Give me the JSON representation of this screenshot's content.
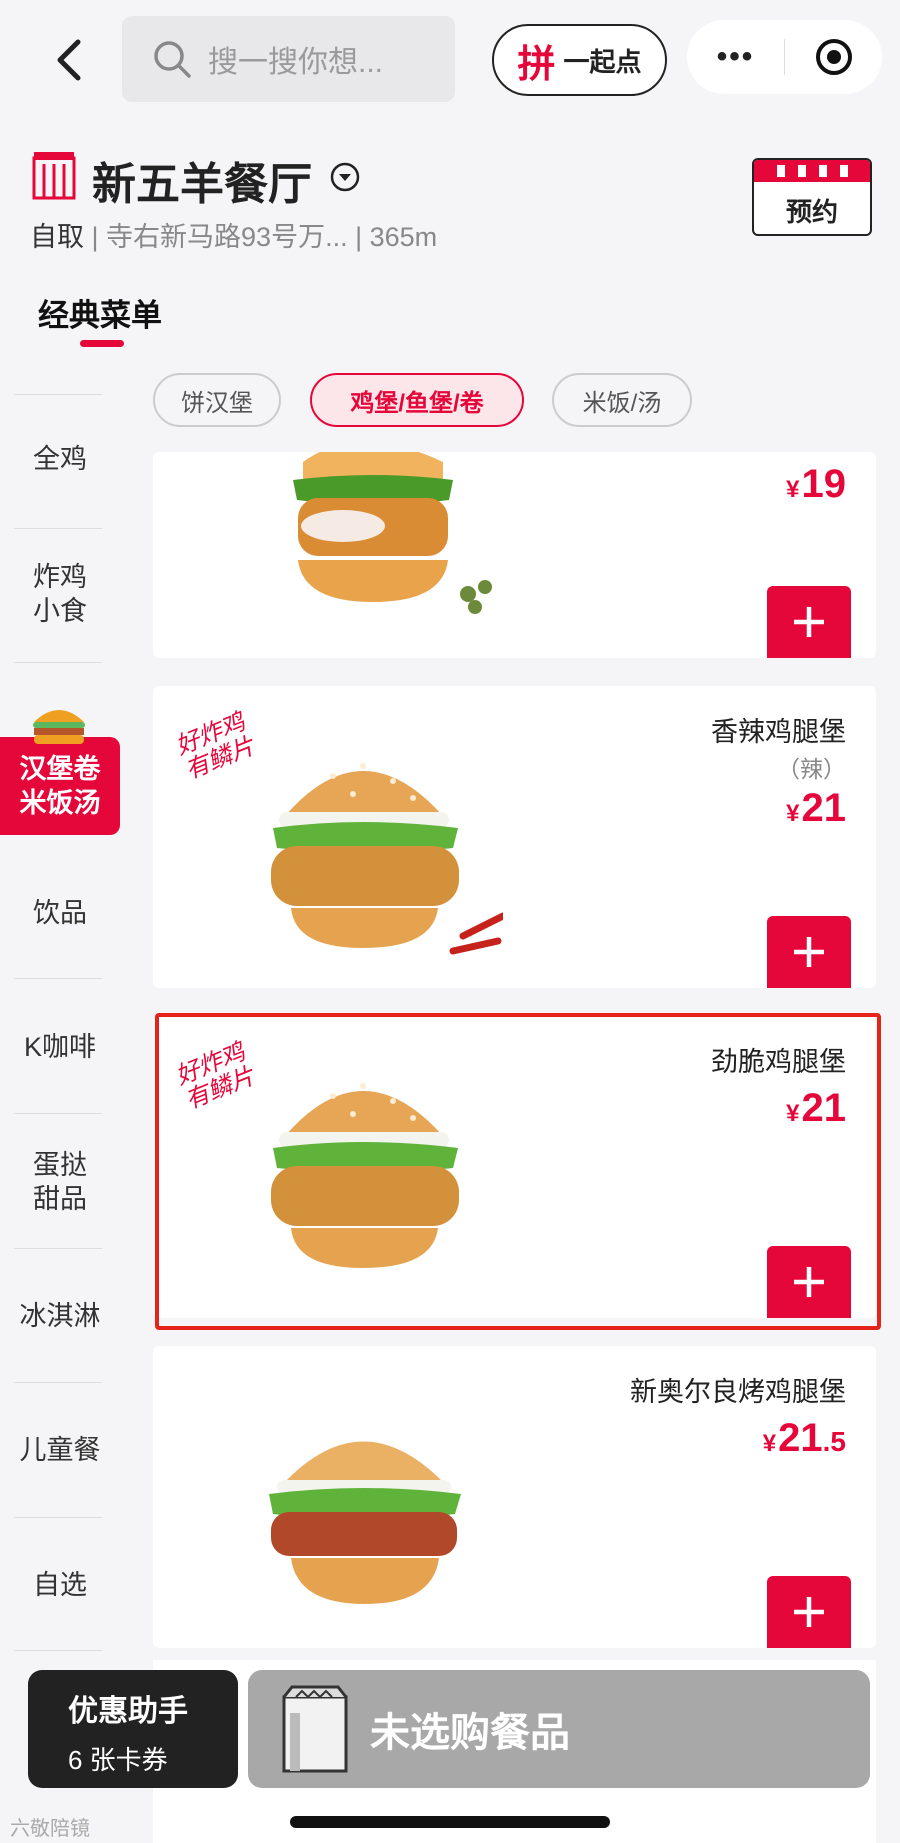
{
  "header": {
    "search_placeholder": "搜一搜你想...",
    "group_pin_glyph": "拼",
    "group_label": "一起点",
    "more_label": "•••"
  },
  "store": {
    "name": "新五羊餐厅",
    "pickup": "自取",
    "address": "| 寺右新马路93号万... | 365m",
    "reserve_label": "预约"
  },
  "menu_tab": "经典菜单",
  "sidebar": {
    "items": [
      "全鸡",
      "炸鸡\n小食",
      "饮品",
      "K咖啡",
      "蛋挞\n甜品",
      "冰淇淋",
      "儿童餐",
      "自选"
    ],
    "active": "汉堡卷\n米饭汤"
  },
  "chips": [
    {
      "label": "饼汉堡",
      "active": false
    },
    {
      "label": "鸡堡/鱼堡/卷",
      "active": true
    },
    {
      "label": "米饭/汤",
      "active": false
    }
  ],
  "products": [
    {
      "name": "",
      "price_int": "19",
      "price_dec": "",
      "currency": "¥"
    },
    {
      "name": "香辣鸡腿堡",
      "note": "（辣）",
      "price_int": "21",
      "price_dec": "",
      "currency": "¥",
      "slogan": "好炸鸡\n有鳞片"
    },
    {
      "name": "劲脆鸡腿堡",
      "price_int": "21",
      "price_dec": "",
      "currency": "¥",
      "slogan": "好炸鸡\n有鳞片",
      "highlighted": true
    },
    {
      "name": "新奥尔良烤鸡腿堡",
      "price_int": "21",
      "price_dec": ".5",
      "currency": "¥"
    }
  ],
  "bottom": {
    "helper_title": "优惠助手",
    "helper_count": "6 张卡券",
    "cart_empty": "未选购餐品"
  },
  "watermark": "六敬陪镜",
  "colors": {
    "brand": "#e5073a",
    "highlight": "#e5231b"
  }
}
